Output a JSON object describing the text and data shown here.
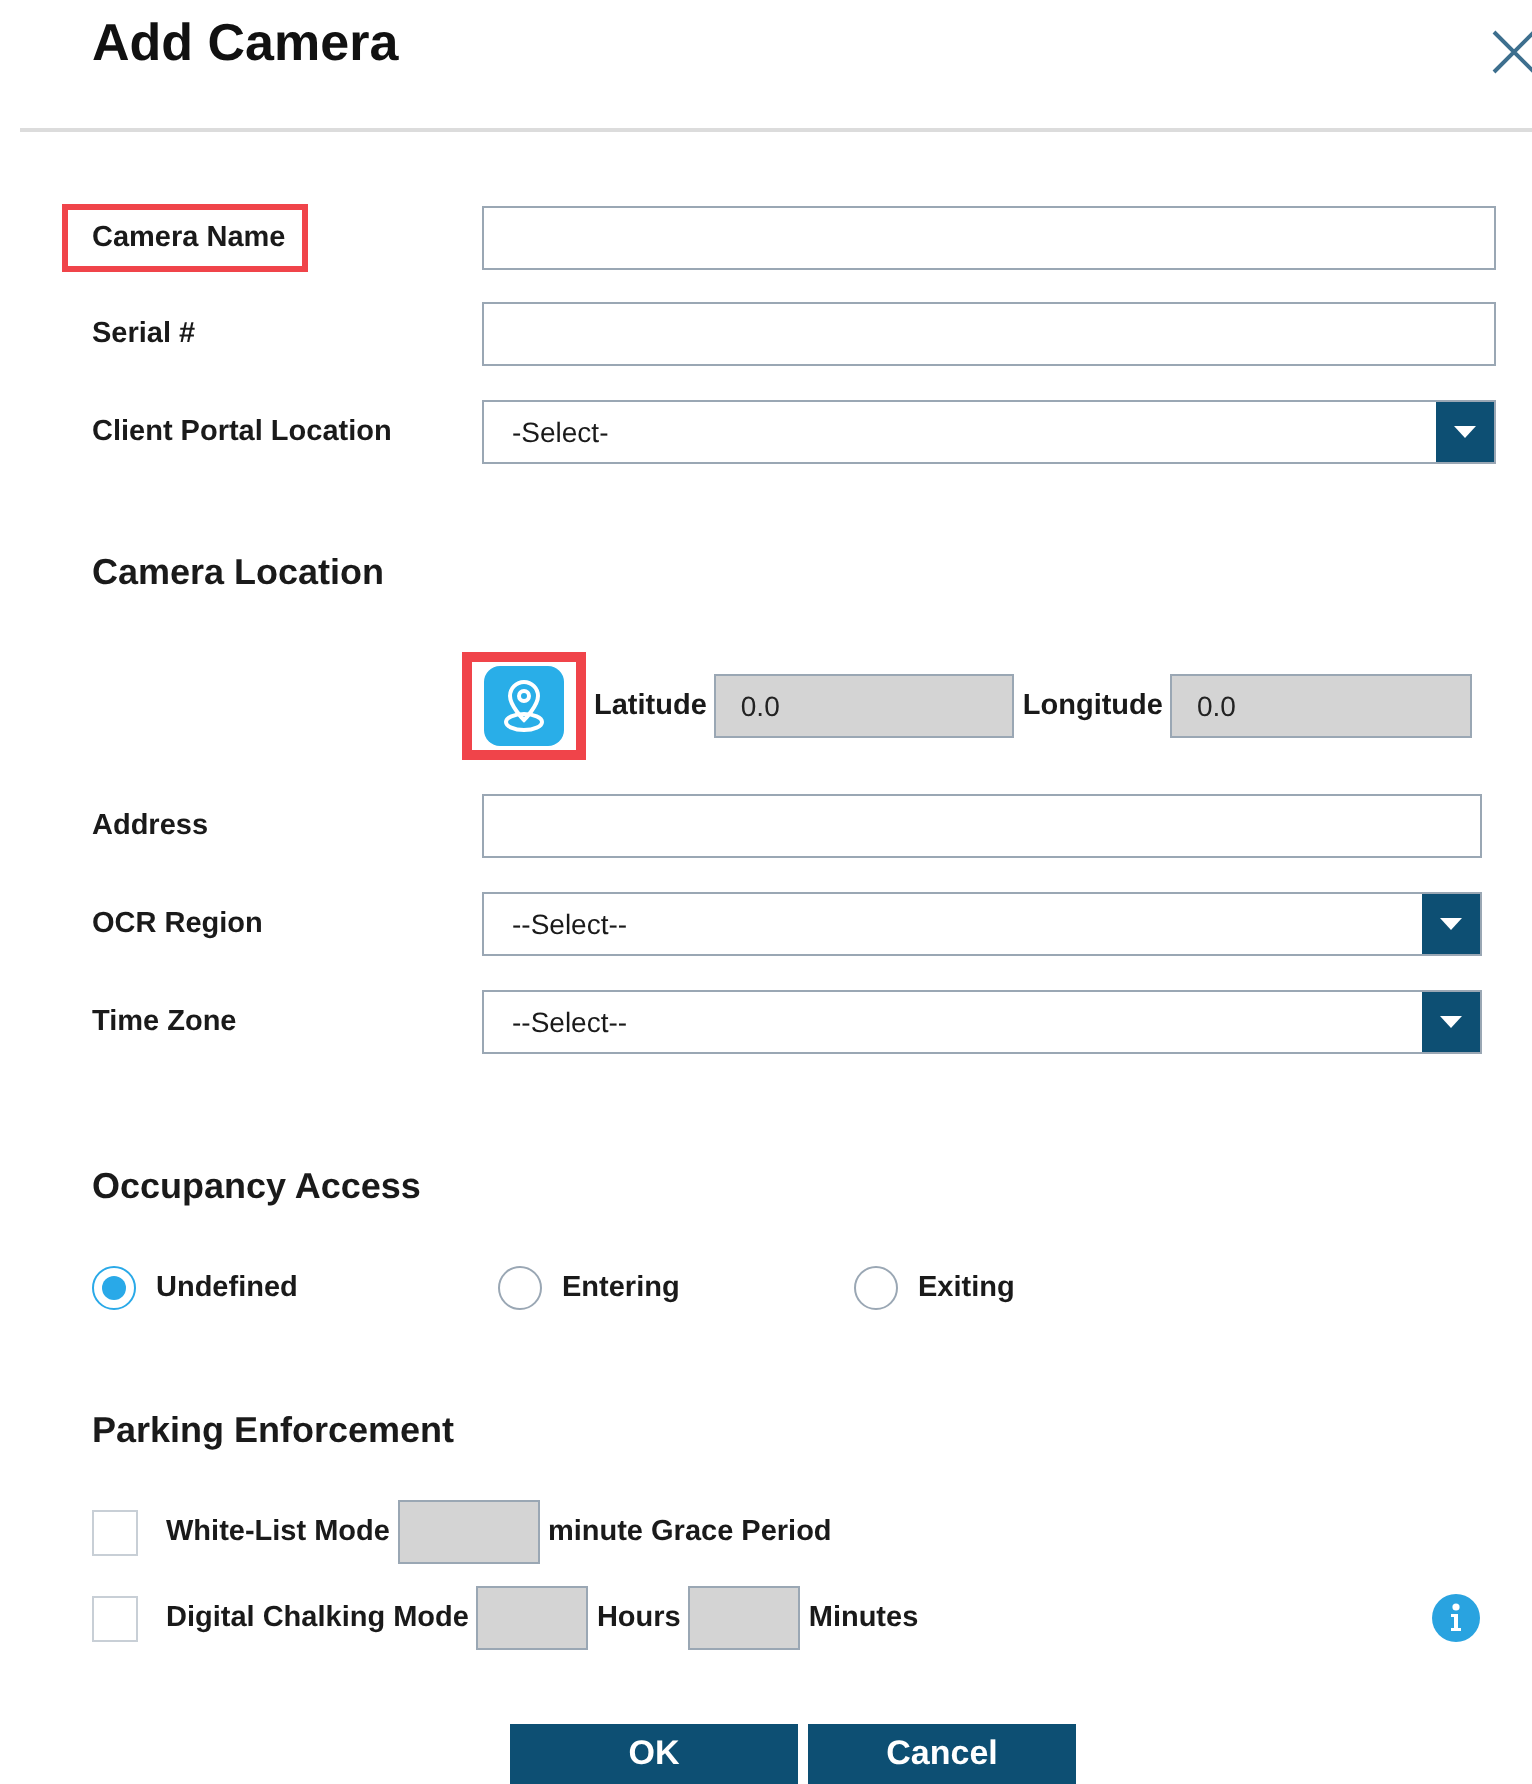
{
  "title": "Add Camera",
  "fields": [
    {
      "label": "Camera Name",
      "kind": "text",
      "highlighted": true
    },
    {
      "label": "Serial #",
      "kind": "text",
      "highlighted": false
    },
    {
      "label": "Client Portal Location",
      "kind": "select",
      "value": "-Select-",
      "highlighted": false
    }
  ],
  "camera_location": {
    "heading": "Camera Location",
    "map_button_highlighted": true,
    "latitude": {
      "label": "Latitude",
      "value": "0.0"
    },
    "longitude": {
      "label": "Longitude",
      "value": "0.0"
    },
    "fields": [
      {
        "label": "Address",
        "kind": "text",
        "highlighted": false
      },
      {
        "label": "OCR Region",
        "kind": "select",
        "value": "--Select--",
        "highlighted": false
      },
      {
        "label": "Time Zone",
        "kind": "select",
        "value": "--Select--",
        "highlighted": false
      }
    ]
  },
  "occupancy": {
    "heading": "Occupancy Access",
    "options": [
      {
        "label": "Undefined",
        "selected": true
      },
      {
        "label": "Entering",
        "selected": false
      },
      {
        "label": "Exiting",
        "selected": false
      }
    ]
  },
  "parking": {
    "heading": "Parking Enforcement",
    "modes": [
      {
        "checked": false,
        "parts": [
          {
            "kind": "text",
            "text": "White-List Mode"
          },
          {
            "kind": "input"
          },
          {
            "kind": "text",
            "text": "minute Grace Period"
          }
        ]
      },
      {
        "checked": false,
        "info": true,
        "parts": [
          {
            "kind": "text",
            "text": "Digital Chalking Mode"
          },
          {
            "kind": "input"
          },
          {
            "kind": "text",
            "text": "Hours"
          },
          {
            "kind": "input"
          },
          {
            "kind": "text",
            "text": "Minutes"
          }
        ]
      }
    ]
  },
  "buttons": [
    {
      "label": "OK"
    },
    {
      "label": "Cancel"
    }
  ]
}
